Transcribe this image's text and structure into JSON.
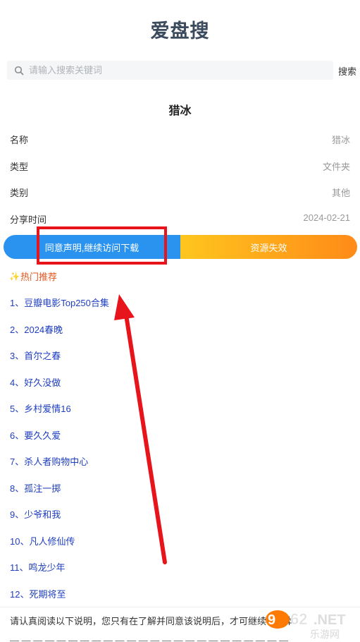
{
  "app": {
    "title": "爱盘搜"
  },
  "search": {
    "placeholder": "请输入搜索关键词",
    "button_label": "搜索"
  },
  "file": {
    "title": "猎冰",
    "fields": [
      {
        "label": "名称",
        "value": "猎冰"
      },
      {
        "label": "类型",
        "value": "文件夹"
      },
      {
        "label": "类别",
        "value": "其他"
      },
      {
        "label": "分享时间",
        "value": "2024-02-21"
      }
    ]
  },
  "actions": {
    "agree_label": "同意声明,继续访问下载",
    "invalid_label": "资源失效",
    "colors": {
      "agree": "#2a93f0",
      "invalid_start": "#ffc61e",
      "invalid_end": "#ff8a18"
    }
  },
  "hot": {
    "header": "热门推荐",
    "items": [
      "1、豆瓣电影Top250合集",
      "2、2024春晚",
      "3、首尔之春",
      "4、好久没做",
      "5、乡村爱情16",
      "6、要久久爱",
      "7、杀人者购物中心",
      "8、孤注一掷",
      "9、少爷和我",
      "10、凡人修仙传",
      "11、鸣龙少年",
      "12、死期将至"
    ]
  },
  "notice": {
    "text": "请认真阅读以下说明，您只有在了解并同意该说明后，才可继续访问本"
  },
  "watermark": {
    "brand": "962",
    "domain": ".NET",
    "sub": "乐游网"
  },
  "annotation": {
    "color": "#e8141b"
  }
}
